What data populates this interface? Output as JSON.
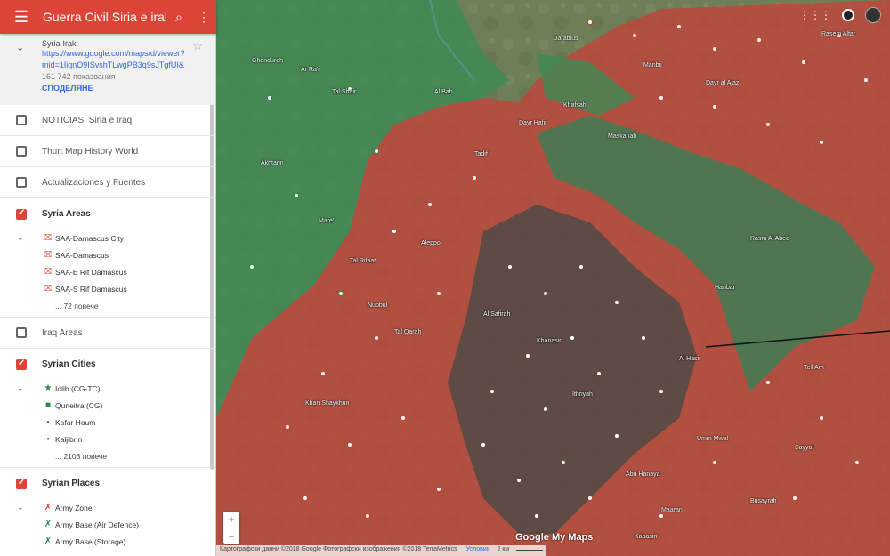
{
  "app": {
    "title": "Guerra Civil Siria e irak"
  },
  "map_info": {
    "name": "Syria-Irak:",
    "url": "https://www.google.com/maps/d/viewer?mid=1IiqnO9ISvshTLwgPB3q9sJTgfUI&",
    "views": "161 742 показвания",
    "share": "СПОДЕЛЯНЕ"
  },
  "layers": [
    {
      "label": "NOTICIAS: Siria e Iraq",
      "checked": false
    },
    {
      "label": "Thurt Map History World",
      "checked": false
    },
    {
      "label": "Actualizaciones y Fuentes",
      "checked": false
    },
    {
      "label": "Syria Areas",
      "checked": true,
      "items": [
        "SAA-Damascus City",
        "SAA-Damascus",
        "SAA-E Rif Damascus",
        "SAA-S Rif Damascus"
      ],
      "more": "... 72 повече"
    },
    {
      "label": "Iraq Areas",
      "checked": false
    },
    {
      "label": "Syrian Cities",
      "checked": true,
      "items": [
        "Idlib (CG-TC)",
        "Quneitra (CG)",
        "Kafar Houm",
        "Kaljibrin"
      ],
      "more": "... 2103 повече"
    },
    {
      "label": "Syrian Places",
      "checked": true,
      "items": [
        "Army Zone",
        "Army Base (Air Defence)",
        "Army Base (Storage)"
      ]
    }
  ],
  "map": {
    "labels": [
      "Ghandurah",
      "Tal Shair",
      "Ar Ra'i",
      "Akhtarin",
      "Mare'",
      "Tal Rifaat",
      "Nubbul",
      "Tal Qarah",
      "Al Bab",
      "Dayr Hafir",
      "Khafsah",
      "Maskanah",
      "Tadif",
      "Aleppo",
      "Al Safirah",
      "Khanasir",
      "Jarablus",
      "Manbij",
      "Dayr al Ajaz",
      "Rasm Al Abed",
      "Hanbar",
      "Al Hasir",
      "Tell Arn",
      "Ithriyah",
      "Umm Mwal",
      "Sayyal",
      "Abu Hanaya",
      "Maaran",
      "Busayrah",
      "Khan Shaykhun",
      "Kabasin",
      "Rasem Alfar"
    ],
    "attribution": "Картографски данни ©2018 Google Фотографски изображения ©2018 TerraMetrics",
    "terms": "Условия",
    "scale": "2 км",
    "logo": "Google My Maps"
  },
  "colors": {
    "accent": "#db4437",
    "saa_zone": "#c0453b",
    "rebel_zone": "#3f8a55",
    "isis_zone": "#4a4a44"
  }
}
